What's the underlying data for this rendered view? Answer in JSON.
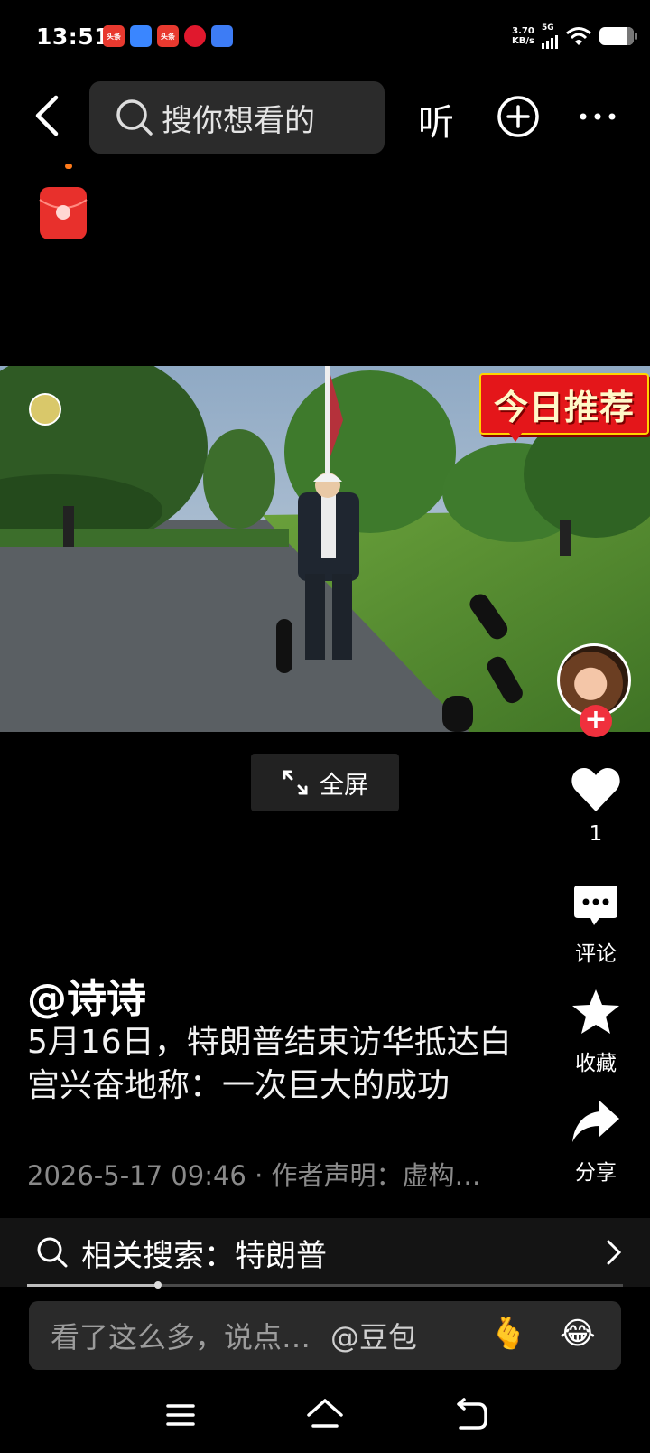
{
  "status_bar": {
    "time": "13:51",
    "app_icons": [
      {
        "name": "toutiao-lite-icon",
        "label": "头条",
        "color": "#e8392f"
      },
      {
        "name": "file-app-icon",
        "label": "",
        "color": "#3a86ff"
      },
      {
        "name": "toutiao-icon",
        "label": "头条",
        "color": "#e8392f"
      },
      {
        "name": "gift-app-icon",
        "label": "",
        "color": "#e0182d"
      },
      {
        "name": "browser-app-icon",
        "label": "",
        "color": "#3d7cf5"
      }
    ],
    "net_speed_value": "3.70",
    "net_speed_unit": "KB/s",
    "network": "5G",
    "battery_level": 0.78
  },
  "top_nav": {
    "search_placeholder": "搜你想看的",
    "listen_label": "听"
  },
  "video": {
    "badge_text": "今日推荐",
    "fullscreen_label": "全屏"
  },
  "rail": {
    "like_count": "1",
    "comment_label": "评论",
    "favorite_label": "收藏",
    "share_label": "分享"
  },
  "post": {
    "username": "@诗诗",
    "caption": "5月16日，特朗普结束访华抵达白宫兴奋地称：一次巨大的成功",
    "meta": "2026-5-17 09:46 · 作者声明：虚构…"
  },
  "related_search": {
    "label": "相关搜索：特朗普",
    "progress": 0.22
  },
  "comment_bar": {
    "placeholder": "看了这么多，说点…",
    "mention": "@豆包",
    "emoji_1": "🫰",
    "emoji_2": "😂"
  },
  "colors": {
    "accent_red": "#f0303d",
    "badge_red": "#e4161a",
    "badge_gold": "#ffd400"
  }
}
